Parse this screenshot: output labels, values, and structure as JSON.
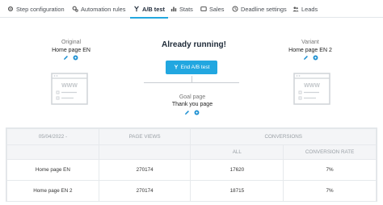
{
  "tabs": [
    {
      "label": "Step configuration",
      "icon": "gear-icon"
    },
    {
      "label": "Automation rules",
      "icon": "cogs-icon"
    },
    {
      "label": "A/B test",
      "icon": "fork-icon"
    },
    {
      "label": "Stats",
      "icon": "bar-chart-icon"
    },
    {
      "label": "Sales",
      "icon": "wallet-icon"
    },
    {
      "label": "Deadline settings",
      "icon": "clock-icon"
    },
    {
      "label": "Leads",
      "icon": "users-icon"
    }
  ],
  "active_tab": "A/B test",
  "experiment": {
    "original_label": "Original",
    "original_page": "Home page EN",
    "variant_label": "Variant",
    "variant_page": "Home page EN 2",
    "status": "Already running!",
    "end_button": "End A/B test",
    "goal_label": "Goal page",
    "goal_page": "Thank you page",
    "browser_text": "WWW"
  },
  "stats": {
    "date": "05/04/2022 -",
    "col_page_views": "PAGE VIEWS",
    "col_conversions": "CONVERSIONS",
    "col_all": "ALL",
    "col_rate": "CONVERSION RATE",
    "rows": [
      {
        "page": "Home page EN",
        "views": "270174",
        "all": "17620",
        "rate": "7%"
      },
      {
        "page": "Home page EN 2",
        "views": "270174",
        "all": "18715",
        "rate": "7%"
      }
    ]
  },
  "colors": {
    "accent": "#22a7e0",
    "icon_blue": "#1b8fd1"
  }
}
